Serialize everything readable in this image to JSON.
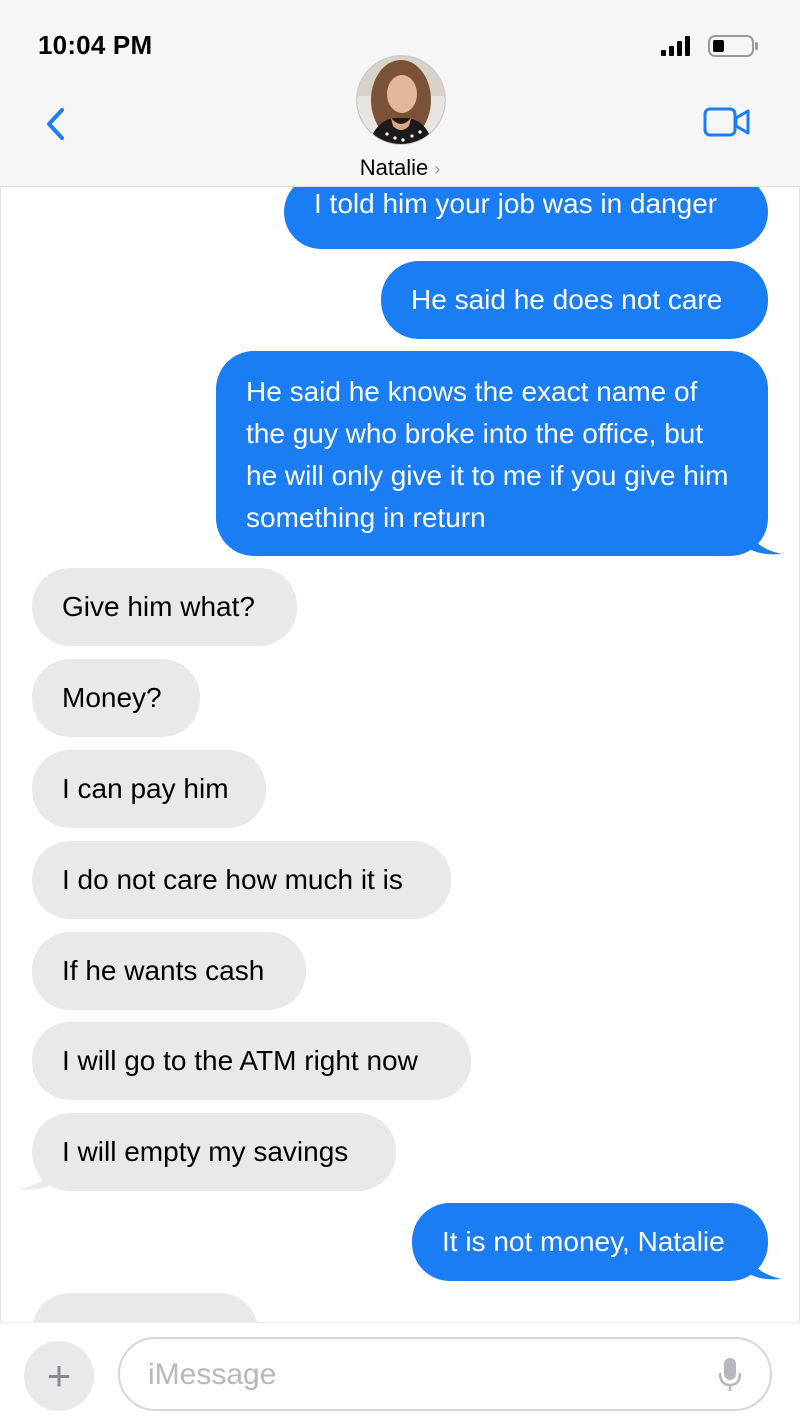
{
  "status_bar": {
    "time": "10:04 PM"
  },
  "header": {
    "contact_name": "Natalie",
    "chevron": "›"
  },
  "messages": [
    {
      "dir": "out",
      "text": "I told him your job was in danger"
    },
    {
      "dir": "out",
      "text": "He said he does not care"
    },
    {
      "dir": "out",
      "text": "He said he knows the exact name of the guy who broke into the office, but he will only give it to me if you give him something in return"
    },
    {
      "dir": "in",
      "text": "Give him what?"
    },
    {
      "dir": "in",
      "text": "Money?"
    },
    {
      "dir": "in",
      "text": "I can pay him"
    },
    {
      "dir": "in",
      "text": "I do not care how much it is"
    },
    {
      "dir": "in",
      "text": "If he wants cash"
    },
    {
      "dir": "in",
      "text": "I will go to the ATM right now"
    },
    {
      "dir": "in",
      "text": "I will empty my savings"
    },
    {
      "dir": "out",
      "text": "It is not money, Natalie"
    },
    {
      "dir": "in",
      "text": ""
    }
  ],
  "composer": {
    "placeholder": "iMessage",
    "plus": "+"
  },
  "icons": {
    "back": "chevron-left-icon",
    "video": "video-camera-icon",
    "signal": "signal-bars-icon",
    "battery": "battery-icon",
    "mic": "microphone-icon"
  },
  "colors": {
    "outgoing_bubble": "#1a7df3",
    "incoming_bubble": "#e9e9eb",
    "accent": "#1a7df3",
    "header_bg": "#f6f6f7"
  }
}
